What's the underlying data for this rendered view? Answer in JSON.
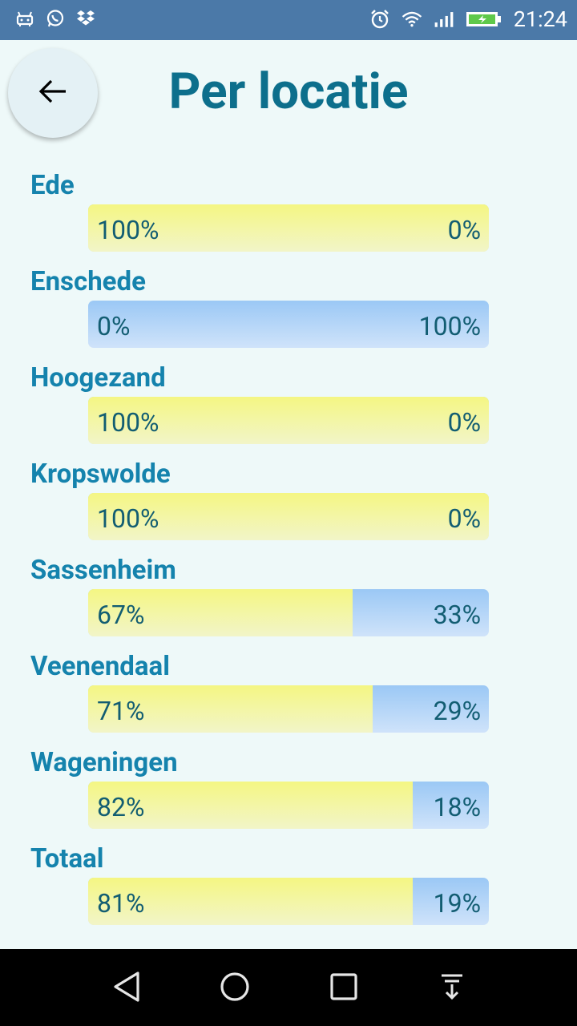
{
  "statusbar": {
    "time": "21:24",
    "left_icons": [
      "android-icon",
      "whatsapp-icon",
      "dropbox-icon"
    ],
    "right_icons": [
      "alarm-icon",
      "wifi-icon",
      "signal-icon",
      "battery-icon"
    ],
    "color": "#4b79a8"
  },
  "header": {
    "title": "Per locatie",
    "back_icon": "arrow-left-icon"
  },
  "colors": {
    "title": "#0d6f8c",
    "label": "#1583ad",
    "percent": "#125d72",
    "yellow": "#f4f683",
    "blue": "#9bc8f5",
    "background": "#eef9f9"
  },
  "locations": [
    {
      "name": "Ede",
      "left": "100%",
      "right": "0%",
      "fraction": 1.0
    },
    {
      "name": "Enschede",
      "left": "0%",
      "right": "100%",
      "fraction": 0.0
    },
    {
      "name": "Hoogezand",
      "left": "100%",
      "right": "0%",
      "fraction": 1.0
    },
    {
      "name": "Kropswolde",
      "left": "100%",
      "right": "0%",
      "fraction": 1.0
    },
    {
      "name": "Sassenheim",
      "left": "67%",
      "right": "33%",
      "fraction": 0.66
    },
    {
      "name": "Veenendaal",
      "left": "71%",
      "right": "29%",
      "fraction": 0.71
    },
    {
      "name": "Wageningen",
      "left": "82%",
      "right": "18%",
      "fraction": 0.81
    },
    {
      "name": "Totaal",
      "left": "81%",
      "right": "19%",
      "fraction": 0.81
    }
  ],
  "navbar": {
    "buttons": [
      "back-triangle-icon",
      "home-circle-icon",
      "recents-square-icon",
      "notification-pull-icon"
    ]
  }
}
